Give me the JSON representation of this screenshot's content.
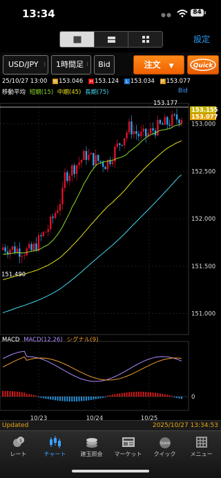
{
  "status_bar": {
    "time": "13:34",
    "battery": "84"
  },
  "header": {
    "settings_label": "設定"
  },
  "toolbar": {
    "pair": "USD/JPY",
    "timeframe": "1時間足",
    "price_type": "Bid",
    "order_label": "注文",
    "quick_label": "Quick"
  },
  "ohlc": {
    "datetime": "25/10/27 13:00",
    "open_box": "始",
    "open": "153.046",
    "high_box": "H",
    "high": "153.124",
    "low_box": "L",
    "low": "153.034",
    "close_box": "終",
    "close": "153.077"
  },
  "ma_legend": {
    "title": "移動平均",
    "short_label": "短期(15)",
    "mid_label": "中期(45)",
    "long_label": "長期(75)",
    "bid": "Bid"
  },
  "colors": {
    "up": "#e0102a",
    "down": "#2fa3e8",
    "short_ma": "#8bdc2c",
    "mid_ma": "#e7e01e",
    "long_ma": "#45d9ef",
    "accent": "#f06000"
  },
  "chart_data": {
    "type": "candlestick",
    "y_ticks": [
      "153.000",
      "152.500",
      "152.000",
      "151.500",
      "151.000"
    ],
    "ylim": [
      150.78,
      153.2
    ],
    "x_ticks": [
      "10/23",
      "10/24",
      "10/25"
    ],
    "price_labels": {
      "high_marker": "153.177",
      "low_marker": "151.490",
      "bid_tag": "153.155",
      "last_tag": "153.077"
    },
    "macd": {
      "title": "MACD",
      "macd_label": "MACD(12,26)",
      "signal_label": "シグナル(9)",
      "zero_label": "0"
    }
  },
  "footer": {
    "updated_label": "Updated",
    "updated_time": "2025/10/27 13:34:53"
  },
  "tabs": [
    {
      "label": "レート",
      "icon": "rate-icon"
    },
    {
      "label": "チャート",
      "icon": "chart-icon"
    },
    {
      "label": "建玉照会",
      "icon": "position-icon"
    },
    {
      "label": "マーケット",
      "icon": "news-icon"
    },
    {
      "label": "クイック",
      "icon": "quick-icon"
    },
    {
      "label": "メニュー",
      "icon": "menu-grid-icon"
    }
  ]
}
